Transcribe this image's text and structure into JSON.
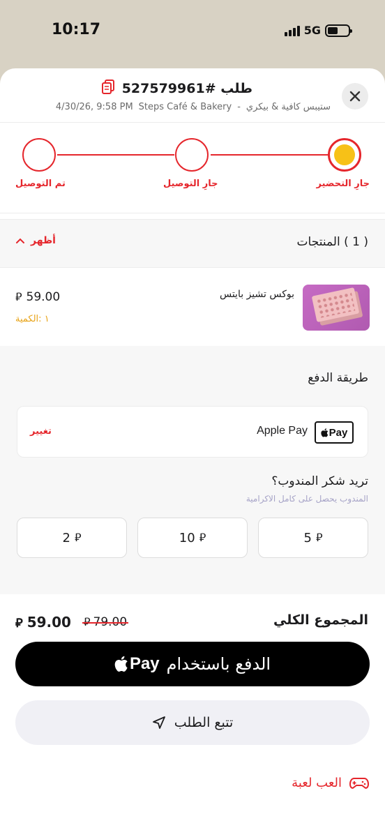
{
  "status_bar": {
    "time": "10:17",
    "network": "5G"
  },
  "header": {
    "order_title": "طلب #527579961",
    "store_ar": "ستيبس كافية & بيكري",
    "separator": "-",
    "store_en": "Steps Café & Bakery",
    "datetime": "4/30/26, 9:58 PM",
    "icons": {
      "close": "close-icon",
      "copy": "copy-icon"
    }
  },
  "progress": {
    "steps": [
      {
        "label": "جارِ التحضير",
        "state": "active"
      },
      {
        "label": "جارِ التوصيل",
        "state": "pending"
      },
      {
        "label": "تم التوصيل",
        "state": "pending"
      }
    ],
    "accent_color": "#e5262c",
    "active_fill": "#f7c117"
  },
  "products": {
    "title": "( 1 ) المنتجات",
    "toggle_label": "أظهر",
    "items": [
      {
        "name": "بوكس تشيز بايتس",
        "price": "59.00",
        "currency": "⃁",
        "qty_label": "١ :الكمية"
      }
    ]
  },
  "payment": {
    "section_title": "طريقة الدفع",
    "method_badge": "Pay",
    "method_name": "Apple Pay",
    "change_label": "تغيير"
  },
  "tip": {
    "title": "تريد شكر المندوب؟",
    "subtitle": "المندوب يحصل على كامل الاكرامية",
    "options": [
      "5",
      "10",
      "2"
    ]
  },
  "total": {
    "label": "المجموع الكلي",
    "new_price": "59.00",
    "old_price": "79.00"
  },
  "actions": {
    "applepay_text": "الدفع باستخدام",
    "applepay_logo": "Pay",
    "track_label": "تتبع الطلب",
    "game_label": "العب لعبة"
  }
}
